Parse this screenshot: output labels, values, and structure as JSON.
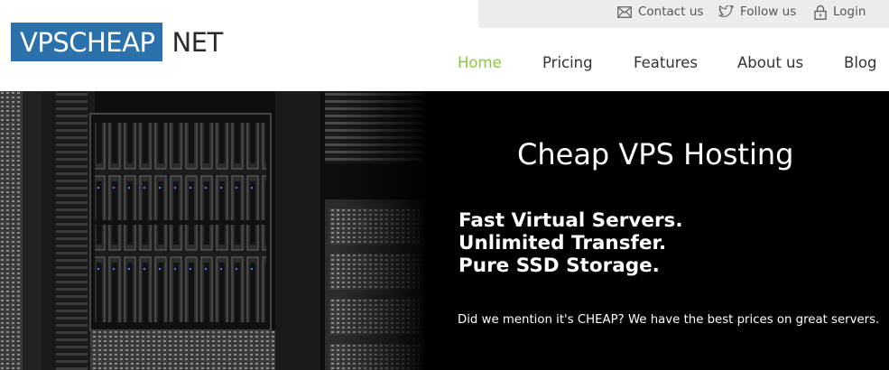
{
  "topbar": {
    "contact_label": "Contact us",
    "follow_label": "Follow us",
    "login_label": "Login",
    "contact_icon": "envelope-icon",
    "follow_icon": "twitter-icon",
    "login_icon": "lock-icon"
  },
  "logo": {
    "primary": "VPSCHEAP",
    "secondary": "NET",
    "brand_color": "#2b72ac"
  },
  "nav": {
    "active_color": "#8cc63e",
    "items": [
      {
        "label": "Home",
        "active": true
      },
      {
        "label": "Pricing",
        "active": false
      },
      {
        "label": "Features",
        "active": false
      },
      {
        "label": "About us",
        "active": false
      },
      {
        "label": "Blog",
        "active": false
      }
    ]
  },
  "hero": {
    "title": "Cheap VPS Hosting",
    "lines": [
      "Fast Virtual Servers.",
      "Unlimited Transfer.",
      "Pure SSD Storage."
    ],
    "note": "Did we mention it's CHEAP? We have the best prices on great servers."
  }
}
